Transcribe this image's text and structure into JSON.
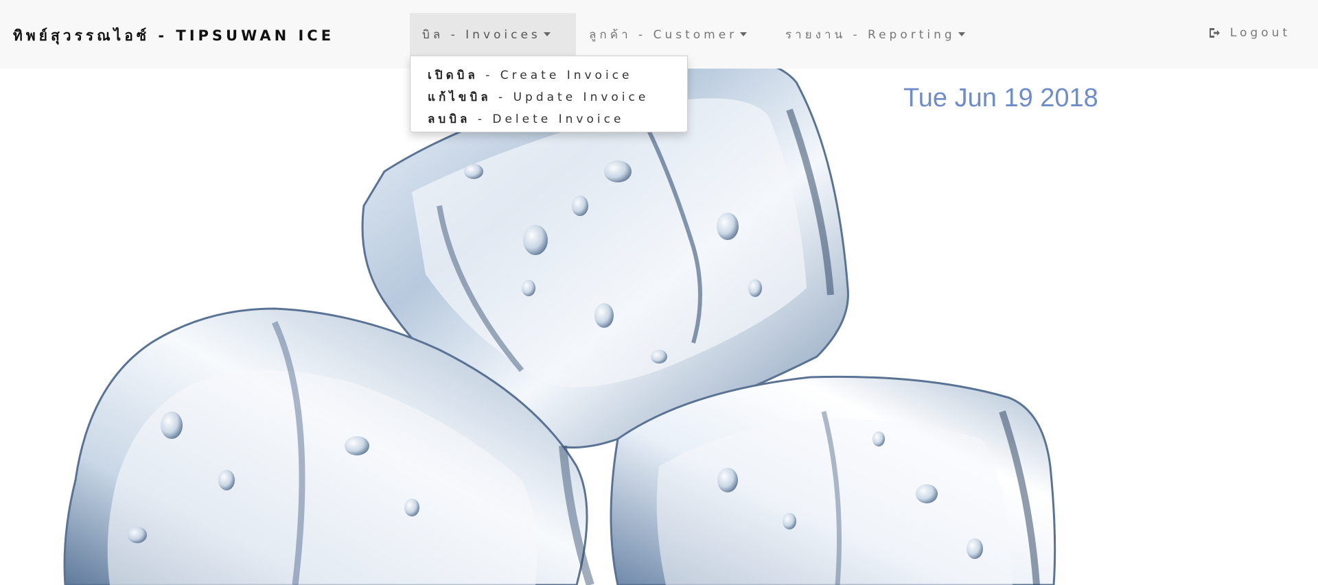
{
  "brand": {
    "title": "ทิพย์สุวรรณไอซ์ - TIPSUWAN ICE"
  },
  "nav": {
    "invoices_label": "บิล - Invoices",
    "customer_label": "ลูกค้า - Customer",
    "reporting_label": "รายงาน - Reporting",
    "logout_label": "Logout",
    "logout_icon": "sign-out-icon"
  },
  "dropdown": {
    "items": [
      {
        "thai": "เปิดบิล",
        "english": " - Create Invoice"
      },
      {
        "thai": "แก้ไขบิล",
        "english": " - Update Invoice"
      },
      {
        "thai": "ลบบิล",
        "english": " - Delete Invoice"
      }
    ]
  },
  "content": {
    "date": "Tue Jun 19 2018"
  },
  "colors": {
    "navbar_bg": "#f8f8f8",
    "active_tab_bg": "#e7e7e7",
    "date_text": "#6d8cc9",
    "background_image_theme": "ice cubes on white"
  }
}
